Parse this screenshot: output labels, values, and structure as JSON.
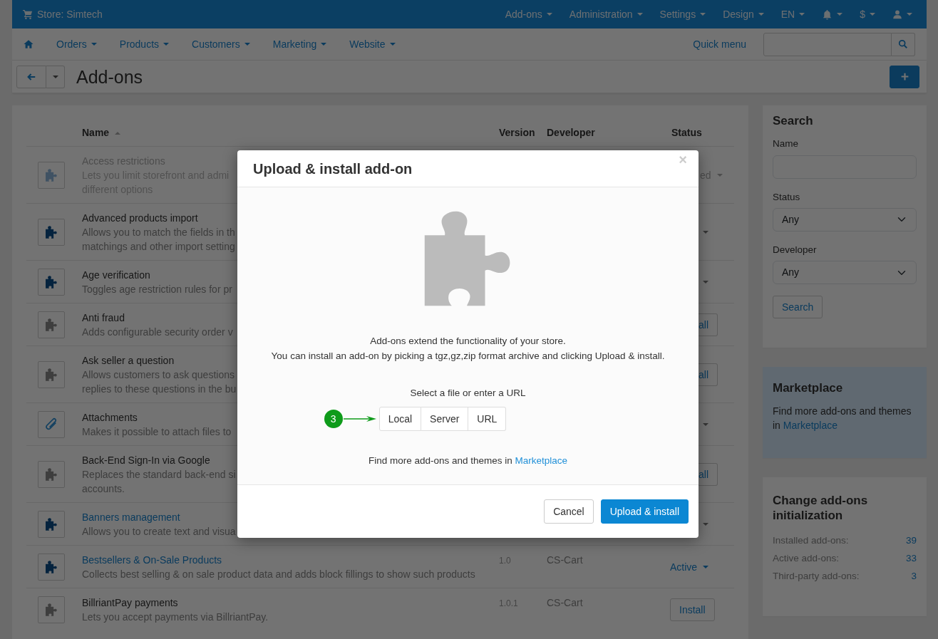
{
  "top_bar": {
    "store": "Store: Simtech",
    "menus": [
      {
        "kind": "text",
        "label": "Add-ons"
      },
      {
        "kind": "text",
        "label": "Administration"
      },
      {
        "kind": "text",
        "label": "Settings"
      },
      {
        "kind": "text",
        "label": "Design"
      },
      {
        "kind": "text",
        "label": "EN"
      },
      {
        "kind": "bell"
      },
      {
        "kind": "text",
        "label": "$"
      },
      {
        "kind": "user"
      }
    ]
  },
  "main_nav": {
    "items": [
      "Orders",
      "Products",
      "Customers",
      "Marketing",
      "Website"
    ],
    "quick_menu": "Quick menu"
  },
  "page": {
    "title": "Add-ons"
  },
  "table": {
    "columns": [
      {
        "label": "Name",
        "sorted": true
      },
      {
        "label": "Version"
      },
      {
        "label": "Developer"
      },
      {
        "label": "Status"
      }
    ],
    "rows": [
      {
        "kind": "puzzle",
        "installed": true,
        "disabled": true,
        "name": "Access restrictions",
        "link": false,
        "description_lines": [
          "Lets you limit storefront and admi",
          "different options"
        ],
        "status": {
          "kind": "dropdown",
          "text": "ed"
        }
      },
      {
        "kind": "puzzle",
        "installed": true,
        "disabled": false,
        "name": "Advanced products import",
        "link": false,
        "description_lines": [
          "Allows you to match the fields in th",
          "matchings and other import setting"
        ],
        "status": {
          "kind": "caret"
        }
      },
      {
        "kind": "puzzle",
        "installed": true,
        "disabled": false,
        "name": "Age verification",
        "link": false,
        "description_lines": [
          "Toggles age restriction rules for pr"
        ],
        "status": {
          "kind": "caret"
        }
      },
      {
        "kind": "puzzle",
        "installed": false,
        "disabled": false,
        "name": "Anti fraud",
        "link": false,
        "description_lines": [
          "Adds configurable security order v"
        ],
        "status": {
          "kind": "cut_button",
          "text": "all"
        }
      },
      {
        "kind": "puzzle",
        "installed": false,
        "disabled": false,
        "name": "Ask seller a question",
        "link": false,
        "description_lines": [
          "Allows customers to ask questions",
          "replies to these questions in the bu"
        ],
        "status": {
          "kind": "cut_button",
          "text": "all"
        }
      },
      {
        "kind": "paperclip",
        "installed": true,
        "disabled": false,
        "name": "Attachments",
        "link": false,
        "description_lines": [
          "Makes it possible to attach files to"
        ],
        "status": {
          "kind": "caret"
        }
      },
      {
        "kind": "puzzle",
        "installed": false,
        "disabled": false,
        "name": "Back-End Sign-In via Google",
        "link": false,
        "description_lines": [
          "Replaces the standard back-end si",
          "accounts."
        ],
        "status": {
          "kind": "cut_button",
          "text": "all"
        }
      },
      {
        "kind": "puzzle",
        "installed": true,
        "disabled": false,
        "name": "Banners management",
        "link": true,
        "description_lines": [
          "Allows you to create text and visua"
        ],
        "status": {
          "kind": "caret"
        }
      },
      {
        "kind": "puzzle",
        "installed": true,
        "disabled": false,
        "name": "Bestsellers & On-Sale Products",
        "link": true,
        "description_lines": [
          "Collects best selling & on sale product data and adds block fillings to show such products"
        ],
        "version": "1.0",
        "developer": "CS-Cart",
        "status": {
          "kind": "dropdown",
          "text": "Active"
        }
      },
      {
        "kind": "puzzle",
        "installed": false,
        "disabled": false,
        "name": "BillriantPay payments",
        "link": false,
        "description_lines": [
          "Lets you accept payments via BillriantPay."
        ],
        "version": "1.0.1",
        "developer": "CS-Cart",
        "status": {
          "kind": "button",
          "text": "Install"
        }
      }
    ]
  },
  "sidebar": {
    "search": {
      "title": "Search",
      "fields": [
        {
          "kind": "input",
          "label": "Name"
        },
        {
          "kind": "select",
          "label": "Status",
          "value": "Any"
        },
        {
          "kind": "select",
          "label": "Developer",
          "value": "Any"
        }
      ],
      "button": "Search"
    },
    "marketplace": {
      "title": "Marketplace",
      "text": "Find more add-ons and themes in ",
      "link": "Marketplace"
    },
    "initialization": {
      "title": "Change add-ons initialization",
      "stats": [
        {
          "label": "Installed add-ons:",
          "value": "39"
        },
        {
          "label": "Active add-ons:",
          "value": "33"
        },
        {
          "label": "Third-party add-ons:",
          "value": "3"
        }
      ]
    }
  },
  "modal": {
    "title": "Upload & install add-on",
    "close": "×",
    "intro_lines": [
      "Add-ons extend the functionality of your store.",
      "You can install an add-on by picking a tgz,gz,zip format archive and clicking Upload & install."
    ],
    "select_label": "Select a file or enter a URL",
    "sources": [
      "Local",
      "Server",
      "URL"
    ],
    "callout": "3",
    "marketplace_text": "Find more add-ons and themes in ",
    "marketplace_link": "Marketplace",
    "buttons": [
      {
        "kind": "secondary",
        "label": "Cancel"
      },
      {
        "kind": "primary",
        "label": "Upload & install"
      }
    ]
  }
}
